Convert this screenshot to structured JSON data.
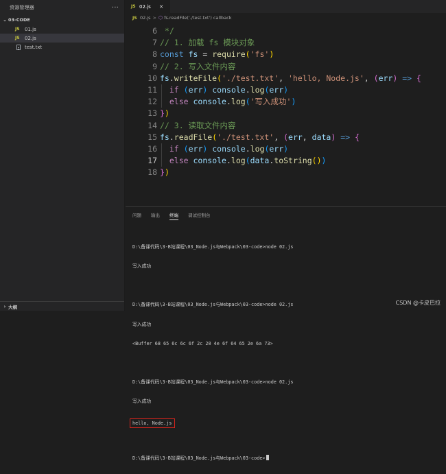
{
  "sidebar": {
    "title": "资源管理器",
    "more_icon": "···",
    "folder_name": "03-CODE",
    "files": [
      {
        "badge": "JS",
        "name": "01.js",
        "active": false
      },
      {
        "badge": "JS",
        "name": "02.js",
        "active": true
      },
      {
        "badge": "",
        "name": "test.txt",
        "active": false
      }
    ],
    "outline_label": "大纲"
  },
  "editor": {
    "tab": {
      "badge": "JS",
      "name": "02.js",
      "close": "×"
    },
    "breadcrumb": {
      "badge": "JS",
      "file": "02.js",
      "separator": ">",
      "symbol": "fs.readFile('./test.txt') callback"
    },
    "current_line": 17,
    "lines": [
      {
        "num": "6",
        "tokens": [
          {
            "t": " */",
            "c": "t-com"
          }
        ]
      },
      {
        "num": "7",
        "tokens": [
          {
            "t": "// 1. 加载 fs 模块对象",
            "c": "t-com"
          }
        ]
      },
      {
        "num": "8",
        "tokens": [
          {
            "t": "const",
            "c": "t-kwb"
          },
          {
            "t": " ",
            "c": "t-op"
          },
          {
            "t": "fs",
            "c": "t-var"
          },
          {
            "t": " = ",
            "c": "t-op"
          },
          {
            "t": "require",
            "c": "t-fn"
          },
          {
            "t": "(",
            "c": "t-p1"
          },
          {
            "t": "'fs'",
            "c": "t-str"
          },
          {
            "t": ")",
            "c": "t-p1"
          }
        ]
      },
      {
        "num": "9",
        "tokens": [
          {
            "t": "// 2. 写入文件内容",
            "c": "t-com"
          }
        ]
      },
      {
        "num": "10",
        "tokens": [
          {
            "t": "fs",
            "c": "t-var"
          },
          {
            "t": ".",
            "c": "t-op"
          },
          {
            "t": "writeFile",
            "c": "t-fn"
          },
          {
            "t": "(",
            "c": "t-p1"
          },
          {
            "t": "'./test.txt'",
            "c": "t-str"
          },
          {
            "t": ", ",
            "c": "t-op"
          },
          {
            "t": "'hello, Node.js'",
            "c": "t-str"
          },
          {
            "t": ", ",
            "c": "t-op"
          },
          {
            "t": "(",
            "c": "t-p2"
          },
          {
            "t": "err",
            "c": "t-var"
          },
          {
            "t": ")",
            "c": "t-p2"
          },
          {
            "t": " ",
            "c": "t-op"
          },
          {
            "t": "=>",
            "c": "t-kwb"
          },
          {
            "t": " ",
            "c": "t-op"
          },
          {
            "t": "{",
            "c": "t-p2"
          }
        ]
      },
      {
        "num": "11",
        "tokens": [
          {
            "t": "  ",
            "c": "t-op"
          },
          {
            "t": "if",
            "c": "t-kw"
          },
          {
            "t": " ",
            "c": "t-op"
          },
          {
            "t": "(",
            "c": "t-p3"
          },
          {
            "t": "err",
            "c": "t-var"
          },
          {
            "t": ")",
            "c": "t-p3"
          },
          {
            "t": " ",
            "c": "t-op"
          },
          {
            "t": "console",
            "c": "t-var"
          },
          {
            "t": ".",
            "c": "t-op"
          },
          {
            "t": "log",
            "c": "t-fn"
          },
          {
            "t": "(",
            "c": "t-p3"
          },
          {
            "t": "err",
            "c": "t-var"
          },
          {
            "t": ")",
            "c": "t-p3"
          }
        ]
      },
      {
        "num": "12",
        "tokens": [
          {
            "t": "  ",
            "c": "t-op"
          },
          {
            "t": "else",
            "c": "t-kw"
          },
          {
            "t": " ",
            "c": "t-op"
          },
          {
            "t": "console",
            "c": "t-var"
          },
          {
            "t": ".",
            "c": "t-op"
          },
          {
            "t": "log",
            "c": "t-fn"
          },
          {
            "t": "(",
            "c": "t-p3"
          },
          {
            "t": "'写入成功'",
            "c": "t-str"
          },
          {
            "t": ")",
            "c": "t-p3"
          }
        ]
      },
      {
        "num": "13",
        "tokens": [
          {
            "t": "}",
            "c": "t-p2"
          },
          {
            "t": ")",
            "c": "t-p1"
          }
        ]
      },
      {
        "num": "14",
        "tokens": [
          {
            "t": "// 3. 读取文件内容",
            "c": "t-com"
          }
        ]
      },
      {
        "num": "15",
        "tokens": [
          {
            "t": "fs",
            "c": "t-var"
          },
          {
            "t": ".",
            "c": "t-op"
          },
          {
            "t": "readFile",
            "c": "t-fn"
          },
          {
            "t": "(",
            "c": "t-p1"
          },
          {
            "t": "'./test.txt'",
            "c": "t-str"
          },
          {
            "t": ", ",
            "c": "t-op"
          },
          {
            "t": "(",
            "c": "t-p2"
          },
          {
            "t": "err",
            "c": "t-var"
          },
          {
            "t": ", ",
            "c": "t-op"
          },
          {
            "t": "data",
            "c": "t-var"
          },
          {
            "t": ")",
            "c": "t-p2"
          },
          {
            "t": " ",
            "c": "t-op"
          },
          {
            "t": "=>",
            "c": "t-kwb"
          },
          {
            "t": " ",
            "c": "t-op"
          },
          {
            "t": "{",
            "c": "t-p2"
          }
        ]
      },
      {
        "num": "16",
        "tokens": [
          {
            "t": "  ",
            "c": "t-op"
          },
          {
            "t": "if",
            "c": "t-kw"
          },
          {
            "t": " ",
            "c": "t-op"
          },
          {
            "t": "(",
            "c": "t-p3"
          },
          {
            "t": "err",
            "c": "t-var"
          },
          {
            "t": ")",
            "c": "t-p3"
          },
          {
            "t": " ",
            "c": "t-op"
          },
          {
            "t": "console",
            "c": "t-var"
          },
          {
            "t": ".",
            "c": "t-op"
          },
          {
            "t": "log",
            "c": "t-fn"
          },
          {
            "t": "(",
            "c": "t-p3"
          },
          {
            "t": "err",
            "c": "t-var"
          },
          {
            "t": ")",
            "c": "t-p3"
          }
        ]
      },
      {
        "num": "17",
        "tokens": [
          {
            "t": "  ",
            "c": "t-op"
          },
          {
            "t": "else",
            "c": "t-kw"
          },
          {
            "t": " ",
            "c": "t-op"
          },
          {
            "t": "console",
            "c": "t-var"
          },
          {
            "t": ".",
            "c": "t-op"
          },
          {
            "t": "log",
            "c": "t-fn"
          },
          {
            "t": "(",
            "c": "t-p3"
          },
          {
            "t": "data",
            "c": "t-var"
          },
          {
            "t": ".",
            "c": "t-op"
          },
          {
            "t": "toString",
            "c": "t-fn"
          },
          {
            "t": "(",
            "c": "t-p1"
          },
          {
            "t": ")",
            "c": "t-p1"
          },
          {
            "t": ")",
            "c": "t-p3"
          }
        ]
      },
      {
        "num": "18",
        "tokens": [
          {
            "t": "}",
            "c": "t-p2"
          },
          {
            "t": ")",
            "c": "t-p1"
          }
        ]
      }
    ]
  },
  "panel": {
    "tabs": [
      "问题",
      "输出",
      "终端",
      "调试控制台"
    ],
    "active_tab": "终端",
    "terminal": {
      "block1": [
        "D:\\备课代码\\3-B站课程\\03_Node.js与Webpack\\03-code>node 02.js",
        "写入成功"
      ],
      "block2": [
        "D:\\备课代码\\3-B站课程\\03_Node.js与Webpack\\03-code>node 02.js",
        "写入成功",
        "<Buffer 68 65 6c 6c 6f 2c 20 4e 6f 64 65 2e 6a 73>"
      ],
      "block3": [
        "D:\\备课代码\\3-B站课程\\03_Node.js与Webpack\\03-code>node 02.js",
        "写入成功"
      ],
      "highlighted_output": "hello, Node.js",
      "prompt": "D:\\备课代码\\3-B站课程\\03_Node.js与Webpack\\03-code>"
    },
    "highlight_color": "#d9251d"
  },
  "watermark": "CSDN @卡皮巴拉"
}
